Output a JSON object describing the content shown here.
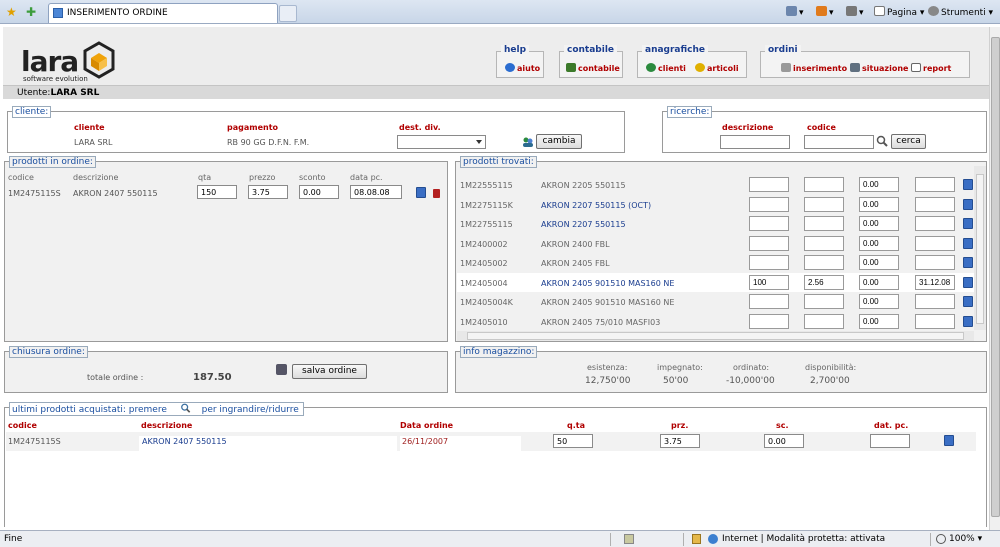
{
  "browser": {
    "tab_title": "INSERIMENTO ORDINE",
    "pagina_label": "Pagina",
    "strumenti_label": "Strumenti"
  },
  "header": {
    "logo_text": "lara",
    "logo_sub": "software evolution",
    "user_label": "Utente:",
    "user_value": "LARA SRL"
  },
  "menus": {
    "help": {
      "title": "help",
      "items": [
        "aiuto"
      ]
    },
    "contabile": {
      "title": "contabile",
      "items": [
        "contabile"
      ]
    },
    "anagrafiche": {
      "title": "anagrafiche",
      "items": [
        "clienti",
        "articoli"
      ]
    },
    "ordini": {
      "title": "ordini",
      "items": [
        "inserimento",
        "situazione",
        "report"
      ]
    }
  },
  "cliente": {
    "legend": "cliente:",
    "col_cliente": "cliente",
    "col_pagamento": "pagamento",
    "col_dest": "dest. div.",
    "cliente_value": "LARA SRL",
    "pagamento_value": "RB 90 GG D.F.N. F.M.",
    "cambia_button": "cambia"
  },
  "ricerche": {
    "legend": "ricerche:",
    "col_descrizione": "descrizione",
    "col_codice": "codice",
    "cerca_button": "cerca"
  },
  "prodotti_ordine": {
    "legend": "prodotti in ordine:",
    "headers": [
      "codice",
      "descrizione",
      "qta",
      "prezzo",
      "sconto",
      "data pc."
    ],
    "rows": [
      {
        "codice": "1M2475115S",
        "descrizione": "AKRON 2407 550115",
        "qta": "150",
        "prezzo": "3.75",
        "sconto": "0.00",
        "data": "08.08.08"
      }
    ]
  },
  "prodotti_trovati": {
    "legend": "prodotti trovati:",
    "rows": [
      {
        "codice": "1M22555115",
        "descrizione": "AKRON 2205 550115",
        "q": "",
        "p": "",
        "s": "0.00",
        "d": "",
        "blue": false
      },
      {
        "codice": "1M2275115K",
        "descrizione": "AKRON 2207 550115 (OCT)",
        "q": "",
        "p": "",
        "s": "0.00",
        "d": "",
        "blue": true
      },
      {
        "codice": "1M22755115",
        "descrizione": "AKRON 2207 550115",
        "q": "",
        "p": "",
        "s": "0.00",
        "d": "",
        "blue": true
      },
      {
        "codice": "1M2400002",
        "descrizione": "AKRON 2400 FBL",
        "q": "",
        "p": "",
        "s": "0.00",
        "d": "",
        "blue": false
      },
      {
        "codice": "1M2405002",
        "descrizione": "AKRON 2405 FBL",
        "q": "",
        "p": "",
        "s": "0.00",
        "d": "",
        "blue": false
      },
      {
        "codice": "1M2405004",
        "descrizione": "AKRON 2405 901510 MAS160 NE",
        "q": "100",
        "p": "2.56",
        "s": "0.00",
        "d": "31.12.08",
        "blue": true
      },
      {
        "codice": "1M2405004K",
        "descrizione": "AKRON 2405 901510 MAS160 NE",
        "q": "",
        "p": "",
        "s": "0.00",
        "d": "",
        "blue": false
      },
      {
        "codice": "1M2405010",
        "descrizione": "AKRON 2405 75/010 MASFI03",
        "q": "",
        "p": "",
        "s": "0.00",
        "d": "",
        "blue": false
      }
    ]
  },
  "chiusura": {
    "legend": "chiusura ordine:",
    "totale_label": "totale ordine :",
    "totale_value": "187.50",
    "salva_button": "salva ordine"
  },
  "magazzino": {
    "legend": "info magazzino:",
    "labels": [
      "esistenza:",
      "impegnato:",
      "ordinato:",
      "disponibilità:"
    ],
    "values": [
      "12,750'00",
      "50'00",
      "-10,000'00",
      "2,700'00"
    ]
  },
  "ultimi": {
    "legend_a": "ultimi prodotti acquistati: premere",
    "legend_b": "per ingrandire/ridurre",
    "headers": [
      "codice",
      "descrizione",
      "Data ordine",
      "q.ta",
      "prz.",
      "sc.",
      "dat. pc."
    ],
    "rows": [
      {
        "codice": "1M2475115S",
        "descrizione": "AKRON 2407 550115",
        "data": "26/11/2007",
        "qta": "50",
        "prz": "3.75",
        "sc": "0.00",
        "dat": ""
      }
    ]
  },
  "status": {
    "left": "Fine",
    "zone": "Internet | Modalità protetta: attivata",
    "zoom": "100%"
  }
}
